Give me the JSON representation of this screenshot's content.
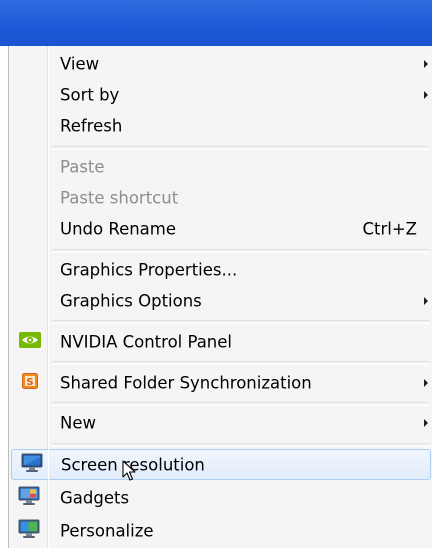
{
  "menu": {
    "view": "View",
    "sort_by": "Sort by",
    "refresh": "Refresh",
    "paste": "Paste",
    "paste_shortcut": "Paste shortcut",
    "undo_rename": "Undo Rename",
    "undo_rename_shortcut": "Ctrl+Z",
    "graphics_properties": "Graphics Properties...",
    "graphics_options": "Graphics Options",
    "nvidia": "NVIDIA Control Panel",
    "shared_folder": "Shared Folder Synchronization",
    "new": "New",
    "screen_resolution": "Screen resolution",
    "gadgets": "Gadgets",
    "personalize": "Personalize"
  },
  "icons": {
    "nvidia": "nvidia-icon",
    "shared_folder": "shared-folder-icon",
    "screen_resolution": "monitor-icon",
    "gadgets": "gadgets-icon",
    "personalize": "personalize-icon"
  },
  "colors": {
    "desktop_blue": "#1b58d6",
    "hover_border": "#aecdf3",
    "disabled_text": "#8d8d8d"
  }
}
